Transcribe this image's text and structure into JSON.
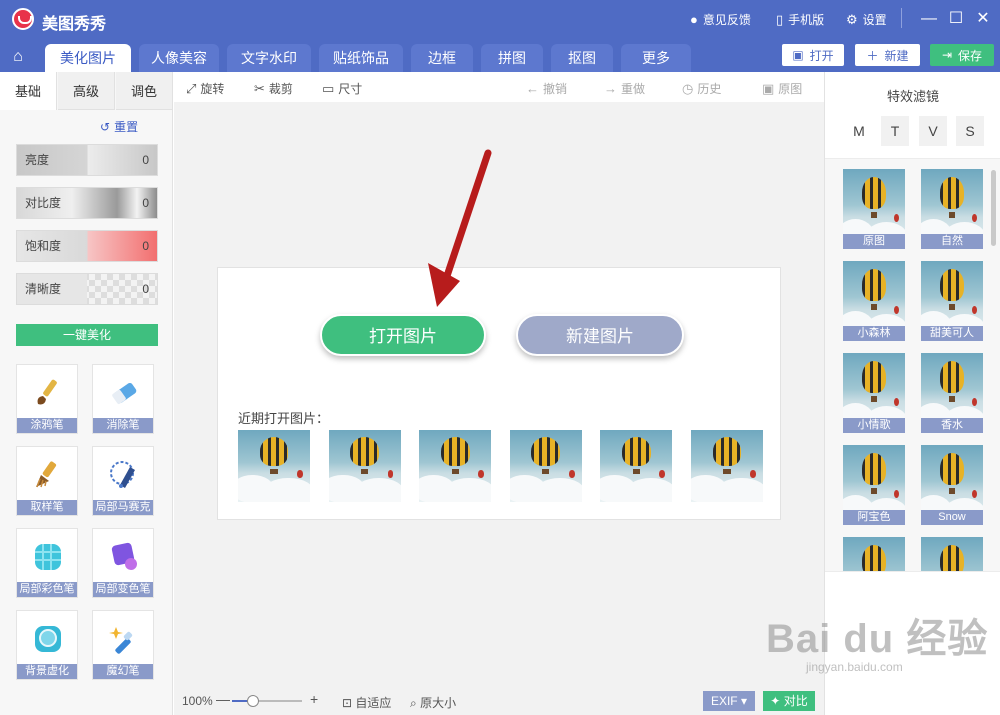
{
  "app": {
    "title": "美图秀秀"
  },
  "titlebar": {
    "feedback": "意见反馈",
    "mobile": "手机版",
    "settings": "设置"
  },
  "tabs": [
    {
      "label": "美化图片",
      "active": true
    },
    {
      "label": "人像美容"
    },
    {
      "label": "文字水印"
    },
    {
      "label": "贴纸饰品"
    },
    {
      "label": "边框"
    },
    {
      "label": "拼图"
    },
    {
      "label": "抠图"
    },
    {
      "label": "更多"
    }
  ],
  "actions": {
    "open": "打开",
    "new": "新建",
    "save": "保存"
  },
  "left_panel": {
    "tabs": [
      "基础",
      "高级",
      "调色"
    ],
    "reset": "重置",
    "adjustments": [
      {
        "label": "亮度",
        "value": "0"
      },
      {
        "label": "对比度",
        "value": "0"
      },
      {
        "label": "饱和度",
        "value": "0"
      },
      {
        "label": "清晰度",
        "value": "0"
      }
    ],
    "one_click": "一键美化",
    "tools": [
      {
        "label": "涂鸦笔",
        "icon": "paint-brush-icon"
      },
      {
        "label": "消除笔",
        "icon": "eraser-icon"
      },
      {
        "label": "取样笔",
        "icon": "clone-brush-icon"
      },
      {
        "label": "局部马赛克",
        "icon": "mosaic-pen-icon"
      },
      {
        "label": "局部彩色笔",
        "icon": "color-pen-icon"
      },
      {
        "label": "局部变色笔",
        "icon": "recolor-pen-icon"
      },
      {
        "label": "背景虚化",
        "icon": "blur-background-icon"
      },
      {
        "label": "魔幻笔",
        "icon": "magic-pen-icon"
      }
    ]
  },
  "toolbar": {
    "rotate": "旋转",
    "crop": "裁剪",
    "size": "尺寸",
    "undo": "撤销",
    "redo": "重做",
    "history": "历史",
    "original": "原图"
  },
  "canvas": {
    "open_image": "打开图片",
    "new_image": "新建图片",
    "recent_label": "近期打开图片：",
    "recent_count": 6
  },
  "zoom": {
    "value": "100%",
    "level": 0.3,
    "fit": "自适应",
    "actual": "原大小",
    "exif": "EXIF",
    "compare": "对比"
  },
  "right_panel": {
    "title": "特效滤镜",
    "tabs": [
      "M",
      "T",
      "V",
      "S"
    ],
    "filters": [
      "原图",
      "自然",
      "小森林",
      "甜美可人",
      "小情歌",
      "香水",
      "阿宝色",
      "Snow"
    ]
  },
  "watermark": {
    "main": "Bai du 经验",
    "sub": "jingyan.baidu.com"
  },
  "colors": {
    "brand": "#4f6bc4",
    "accent_green": "#3fbf7f",
    "label_purple": "#8a9ac9",
    "arrow_red": "#b71c1c"
  }
}
